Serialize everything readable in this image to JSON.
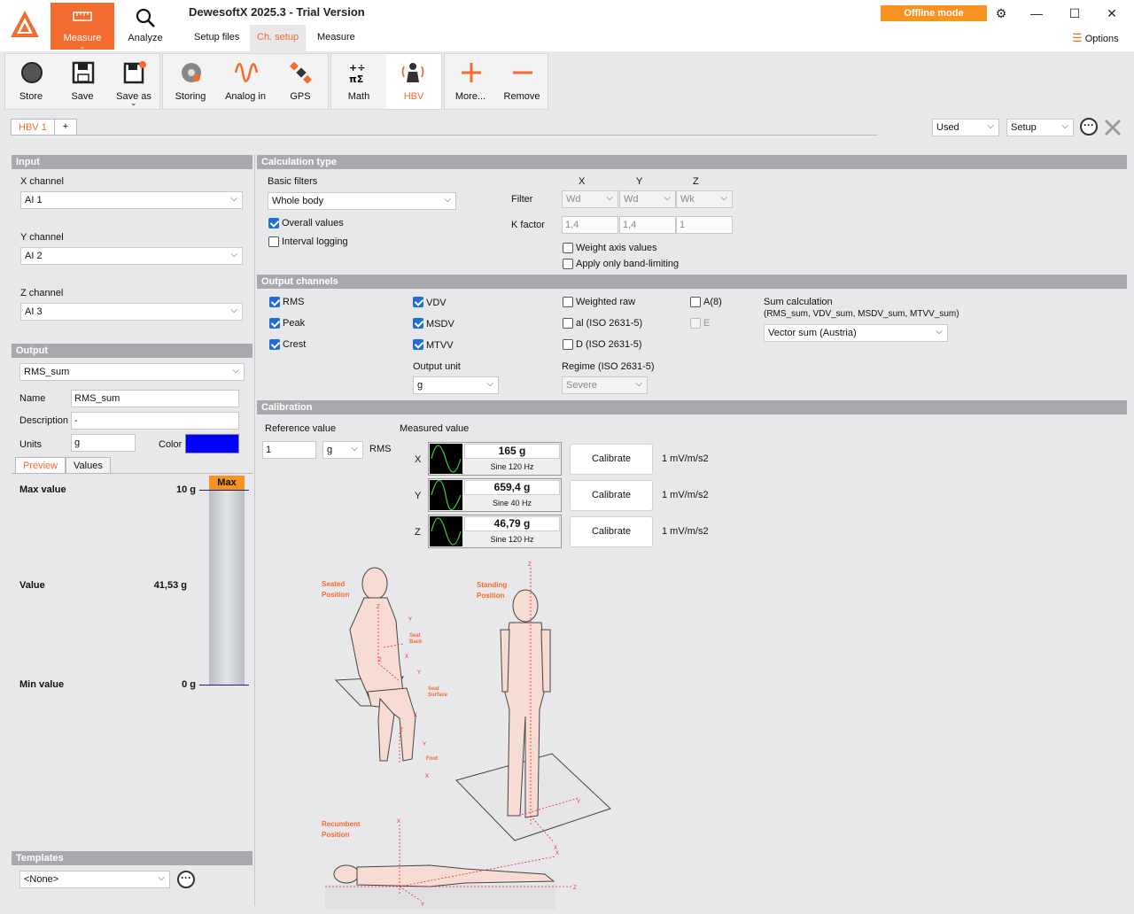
{
  "app": {
    "title": "DewesoftX 2025.3 - Trial Version",
    "offline_mode": "Offline mode",
    "options": "Options"
  },
  "modes": {
    "measure": "Measure",
    "analyze": "Analyze"
  },
  "subtabs": [
    "Setup files",
    "Ch. setup",
    "Measure"
  ],
  "toolbar": {
    "store": "Store",
    "save": "Save",
    "save_as": "Save as",
    "storing": "Storing",
    "analog_in": "Analog in",
    "gps": "GPS",
    "math": "Math",
    "hbv": "HBV",
    "more": "More...",
    "remove": "Remove"
  },
  "channel_tabs": {
    "active": "HBV 1",
    "add": "+"
  },
  "filters": {
    "used": "Used",
    "setup": "Setup"
  },
  "input": {
    "header": "Input",
    "x_label": "X channel",
    "x_value": "AI 1",
    "y_label": "Y channel",
    "y_value": "AI 2",
    "z_label": "Z channel",
    "z_value": "AI 3"
  },
  "output": {
    "header": "Output",
    "selected": "RMS_sum",
    "name_label": "Name",
    "name_value": "RMS_sum",
    "desc_label": "Description",
    "desc_value": "-",
    "units_label": "Units",
    "units_value": "g",
    "color_label": "Color",
    "color": "#0000ff",
    "tab_preview": "Preview",
    "tab_values": "Values",
    "max_label": "Max value",
    "max_value": "10 g",
    "value_label": "Value",
    "value_value": "41,53 g",
    "min_label": "Min value",
    "min_value": "0 g",
    "bar_label": "Max"
  },
  "templates": {
    "header": "Templates",
    "value": "<None>"
  },
  "calc": {
    "header": "Calculation type",
    "basic_filters": "Basic filters",
    "filter_value": "Whole body",
    "overall": "Overall values",
    "interval": "Interval logging",
    "x": "X",
    "y": "Y",
    "z": "Z",
    "filter_label": "Filter",
    "fx": "Wd",
    "fy": "Wd",
    "fz": "Wk",
    "k_label": "K factor",
    "kx": "1,4",
    "ky": "1,4",
    "kz": "1",
    "weight_axis": "Weight axis values",
    "band_limiting": "Apply only band-limiting"
  },
  "outch": {
    "header": "Output channels",
    "rms": "RMS",
    "peak": "Peak",
    "crest": "Crest",
    "vdv": "VDV",
    "msdv": "MSDV",
    "mtvv": "MTVV",
    "weighted_raw": "Weighted raw",
    "al": "al (ISO 2631-5)",
    "d": "D (ISO 2631-5)",
    "a8": "A(8)",
    "e": "E",
    "sum_label": "Sum calculation",
    "sum_sub": "(RMS_sum, VDV_sum, MSDV_sum, MTVV_sum)",
    "sum_value": "Vector sum (Austria)",
    "unit_label": "Output unit",
    "unit_value": "g",
    "regime_label": "Regime (ISO 2631-5)",
    "regime_value": "Severe"
  },
  "calib": {
    "header": "Calibration",
    "ref_label": "Reference value",
    "ref_value": "1",
    "ref_unit": "g",
    "rms": "RMS",
    "meas_label": "Measured value",
    "rows": [
      {
        "axis": "X",
        "value": "165 g",
        "sub": "Sine 120 Hz",
        "btn": "Calibrate",
        "sens": "1 mV/m/s2"
      },
      {
        "axis": "Y",
        "value": "659,4 g",
        "sub": "Sine 40 Hz",
        "btn": "Calibrate",
        "sens": "1 mV/m/s2"
      },
      {
        "axis": "Z",
        "value": "46,79 g",
        "sub": "Sine 120 Hz",
        "btn": "Calibrate",
        "sens": "1 mV/m/s2"
      }
    ]
  },
  "diagram": {
    "seated": "Seated Position",
    "standing": "Standing Position",
    "recumbent": "Recumbent Position",
    "seat_back": "Seat Back",
    "seat_surface": "Seat Surface",
    "foot": "Foot"
  }
}
